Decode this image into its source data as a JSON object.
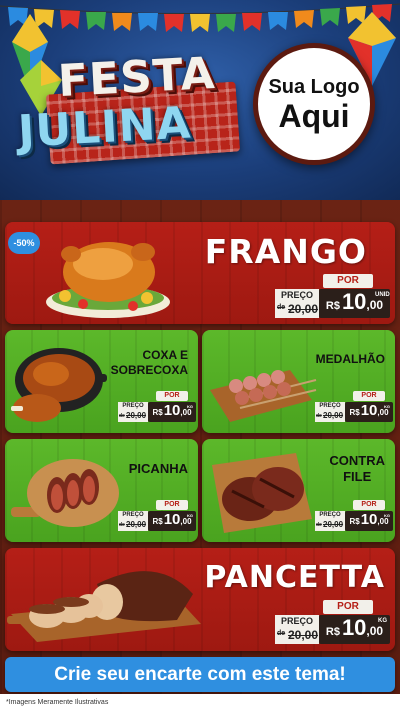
{
  "header": {
    "title_line1": "FESTA",
    "title_line2": "JULINA",
    "logo_line1": "Sua Logo",
    "logo_line2": "Aqui"
  },
  "colors": {
    "accent_red": "#b51f17",
    "accent_green": "#5cb82a",
    "accent_blue": "#2f8fe0",
    "dark_tag": "#2b1f1a"
  },
  "badge": {
    "discount": "-50%"
  },
  "products": [
    {
      "name": "FRANGO",
      "icon": "roast-chicken-image",
      "por": "POR",
      "preco": "PREÇO",
      "de": "de",
      "old_price": "20,00",
      "currency": "R$",
      "price_int": "10",
      "price_dec": ",00",
      "unit": "UNID"
    },
    {
      "name_l1": "COXA E",
      "name_l2": "SOBRECOXA",
      "icon": "chicken-legs-image",
      "por": "POR",
      "preco": "PREÇO",
      "de": "de",
      "old_price": "20,00",
      "currency": "R$",
      "price_int": "10",
      "price_dec": ",00",
      "unit": "KG"
    },
    {
      "name": "MEDALHÃO",
      "icon": "skewers-image",
      "por": "POR",
      "preco": "PREÇO",
      "de": "de",
      "old_price": "20,00",
      "currency": "R$",
      "price_int": "10",
      "price_dec": ",00",
      "unit": "KG"
    },
    {
      "name": "PICANHA",
      "icon": "sliced-steak-image",
      "por": "POR",
      "preco": "PREÇO",
      "de": "de",
      "old_price": "20,00",
      "currency": "R$",
      "price_int": "10",
      "price_dec": ",00",
      "unit": "KG"
    },
    {
      "name_l1": "CONTRA",
      "name_l2": "FILE",
      "icon": "grilled-steak-image",
      "por": "POR",
      "preco": "PREÇO",
      "de": "de",
      "old_price": "20,00",
      "currency": "R$",
      "price_int": "10",
      "price_dec": ",00",
      "unit": "KG"
    },
    {
      "name": "PANCETTA",
      "icon": "roast-pork-image",
      "por": "POR",
      "preco": "PREÇO",
      "de": "de",
      "old_price": "20,00",
      "currency": "R$",
      "price_int": "10",
      "price_dec": ",00",
      "unit": "KG"
    }
  ],
  "cta": {
    "label": "Crie seu encarte com este tema!"
  },
  "footer": {
    "note": "*Imagens Meramente Ilustrativas"
  }
}
